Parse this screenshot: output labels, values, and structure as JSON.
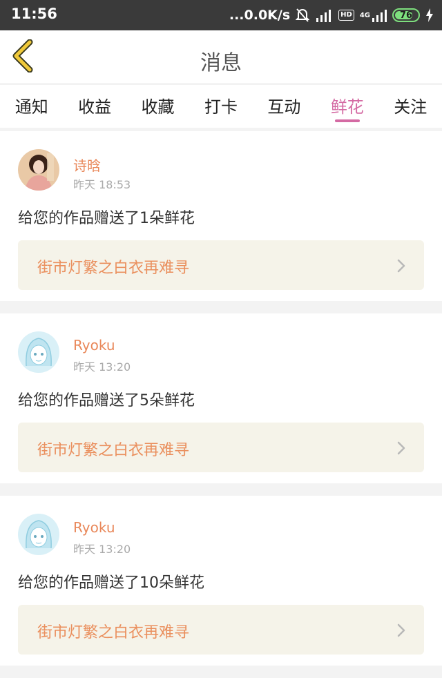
{
  "status_bar": {
    "time": "11:56",
    "network_speed": "...0.0K/s",
    "hd_label": "HD",
    "network_type": "4G",
    "battery_level": "76",
    "battery_fraction": 0.76
  },
  "header": {
    "title": "消息"
  },
  "tabs": [
    {
      "label": "通知",
      "active": false
    },
    {
      "label": "收益",
      "active": false
    },
    {
      "label": "收藏",
      "active": false
    },
    {
      "label": "打卡",
      "active": false
    },
    {
      "label": "互动",
      "active": false
    },
    {
      "label": "鲜花",
      "active": true
    },
    {
      "label": "关注",
      "active": false
    }
  ],
  "messages": [
    {
      "username": "诗晗",
      "time": "昨天 18:53",
      "text": "给您的作品赠送了1朵鲜花",
      "work_title": "街市灯繁之白衣再难寻"
    },
    {
      "username": "Ryoku",
      "time": "昨天 13:20",
      "text": "给您的作品赠送了5朵鲜花",
      "work_title": "街市灯繁之白衣再难寻"
    },
    {
      "username": "Ryoku",
      "time": "昨天 13:20",
      "text": "给您的作品赠送了10朵鲜花",
      "work_title": "街市灯繁之白衣再难寻"
    }
  ],
  "colors": {
    "accent_pink": "#d46aa3",
    "username_orange": "#e9885a",
    "link_bg": "#f5f3e9",
    "back_arrow": "#f0c93a"
  }
}
